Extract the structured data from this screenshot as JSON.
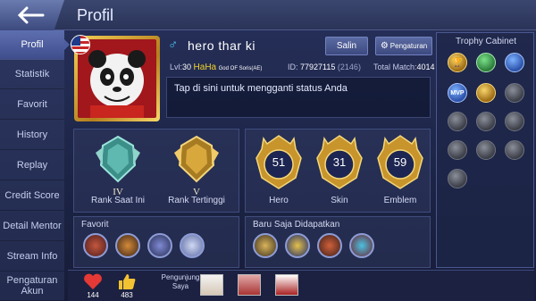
{
  "header": {
    "title": "Profil",
    "back_label": ""
  },
  "sidebar": {
    "items": [
      {
        "label": "Profil",
        "active": true
      },
      {
        "label": "Statistik"
      },
      {
        "label": "Favorit"
      },
      {
        "label": "History"
      },
      {
        "label": "Replay"
      },
      {
        "label": "Credit Score"
      },
      {
        "label": "Detail Mentor"
      },
      {
        "label": "Stream Info"
      },
      {
        "label": "Pengaturan Akun"
      }
    ]
  },
  "profile": {
    "gender_icon": "male-icon",
    "name": "hero thar ki",
    "copy_label": "Salin",
    "settings_label": "Pengaturan",
    "level_prefix": "Lvl:",
    "level": "30",
    "squad": "HaHa",
    "squad_tag": "God OF Soris(AE)",
    "id_prefix": "ID:",
    "id": "77927115",
    "server": "(2146)",
    "total_match_prefix": "Total Match:",
    "total_match": "4014",
    "status_text": "Tap di sini untuk mengganti status Anda",
    "flag": "us-flag"
  },
  "ranks": [
    {
      "label": "Rank Saat Ini",
      "tier": "IV",
      "color": "#7fd1c8"
    },
    {
      "label": "Rank Tertinggi",
      "tier": "V",
      "color": "#e0b54a"
    }
  ],
  "stats": [
    {
      "label": "Hero",
      "value": "51"
    },
    {
      "label": "Skin",
      "value": "31"
    },
    {
      "label": "Emblem",
      "value": "59"
    }
  ],
  "favorites": {
    "title": "Favorit",
    "heroes": [
      "hero-1",
      "hero-2",
      "hero-3",
      "hero-4"
    ]
  },
  "recent": {
    "title": "Baru Saja Didapatkan",
    "items": [
      "item-1",
      "item-2",
      "item-3",
      "item-4"
    ]
  },
  "trophy": {
    "title": "Trophy Cabinet",
    "items": [
      {
        "icon": "cup-icon",
        "tone": "gold"
      },
      {
        "icon": "team-icon",
        "tone": "green"
      },
      {
        "icon": "wings-icon",
        "tone": "blue"
      },
      {
        "icon": "mvp-icon",
        "tone": "blue",
        "text": "MVP"
      },
      {
        "icon": "crest-icon",
        "tone": "gold"
      },
      {
        "icon": "wing-icon",
        "tone": "grey"
      },
      {
        "icon": "shield-icon",
        "tone": "grey"
      },
      {
        "icon": "crest-icon",
        "tone": "grey"
      },
      {
        "icon": "badge-icon",
        "tone": "grey"
      },
      {
        "icon": "crown-icon",
        "tone": "grey"
      },
      {
        "icon": "medal-icon",
        "tone": "grey"
      },
      {
        "icon": "star-icon",
        "tone": "grey"
      },
      {
        "icon": "wing-icon",
        "tone": "grey"
      }
    ]
  },
  "bottom": {
    "likes_count": "144",
    "thumbs_count": "483",
    "visitors_label": "Pengunjung Saya"
  }
}
